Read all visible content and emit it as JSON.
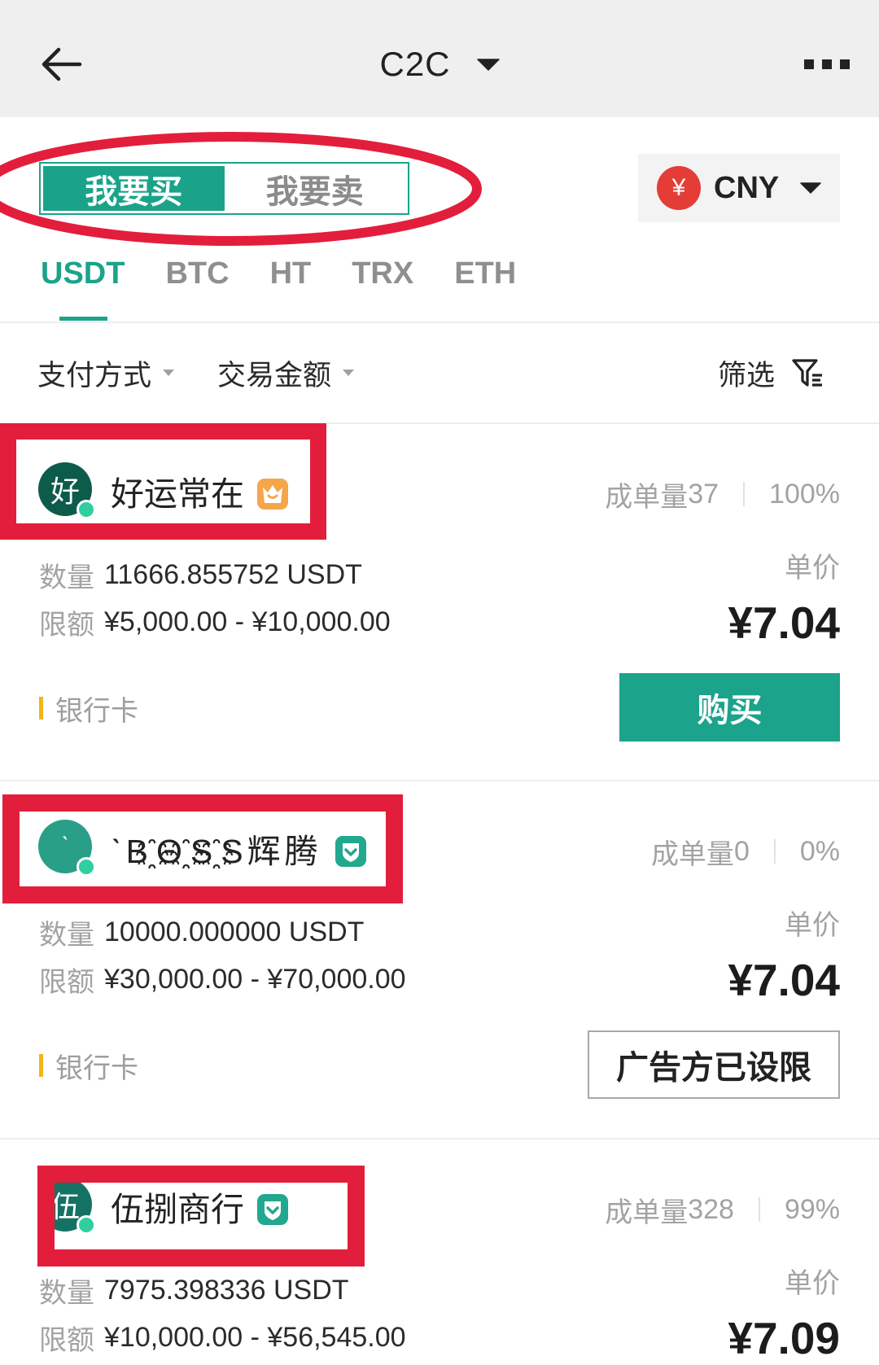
{
  "header": {
    "title": "C2C",
    "back_icon": "arrow-left-icon",
    "title_dropdown_icon": "caret-down-icon",
    "menu_icon": "more-dots-icon"
  },
  "trade_toggle": {
    "buy_label": "我要买",
    "sell_label": "我要卖",
    "buy_active": true
  },
  "currency": {
    "icon": "yuan-icon",
    "symbol": "¥",
    "code": "CNY"
  },
  "coin_tabs": [
    {
      "label": "USDT",
      "active": true
    },
    {
      "label": "BTC",
      "active": false
    },
    {
      "label": "HT",
      "active": false
    },
    {
      "label": "TRX",
      "active": false
    },
    {
      "label": "ETH",
      "active": false
    }
  ],
  "filters": {
    "payment_label": "支付方式",
    "amount_label": "交易金额",
    "filter_label": "筛选",
    "filter_icon": "funnel-icon"
  },
  "listings": [
    {
      "avatar_char": "好",
      "avatar_color": "#0d5b4a",
      "online": true,
      "name": "好运常在",
      "badge_icon": "crown-icon",
      "orders_label": "成单量",
      "orders": "37",
      "completion_rate": "100%",
      "quantity_label": "数量",
      "quantity": "11666.855752 USDT",
      "limit_label": "限额",
      "limit": "¥5,000.00 - ¥10,000.00",
      "price_label": "单价",
      "price": "¥7.04",
      "payment_method": "银行卡",
      "action_label": "购买",
      "action_enabled": true
    },
    {
      "avatar_char": "ˋ",
      "avatar_color": "#2a9f88",
      "online": true,
      "name": "ˋB҈Θ҈S҈S辉腾",
      "badge_icon": "verified-icon",
      "orders_label": "成单量",
      "orders": "0",
      "completion_rate": "0%",
      "quantity_label": "数量",
      "quantity": "10000.000000 USDT",
      "limit_label": "限额",
      "limit": "¥30,000.00 - ¥70,000.00",
      "price_label": "单价",
      "price": "¥7.04",
      "payment_method": "银行卡",
      "action_label": "广告方已设限",
      "action_enabled": false
    },
    {
      "avatar_char": "伍",
      "avatar_color": "#157262",
      "online": true,
      "name": "伍捌商行",
      "badge_icon": "verified-icon",
      "orders_label": "成单量",
      "orders": "328",
      "completion_rate": "99%",
      "quantity_label": "数量",
      "quantity": "7975.398336 USDT",
      "limit_label": "限额",
      "limit": "¥10,000.00 - ¥56,545.00",
      "price_label": "单价",
      "price": "¥7.09"
    }
  ],
  "colors": {
    "accent": "#1ba38a",
    "annotation_red": "#e31e3c",
    "currency_icon": "#e43c36",
    "payment_bar": "#f3b51a",
    "crown_badge": "#f5a54a",
    "verified_badge": "#22a88e",
    "header_bg": "#efefef"
  }
}
